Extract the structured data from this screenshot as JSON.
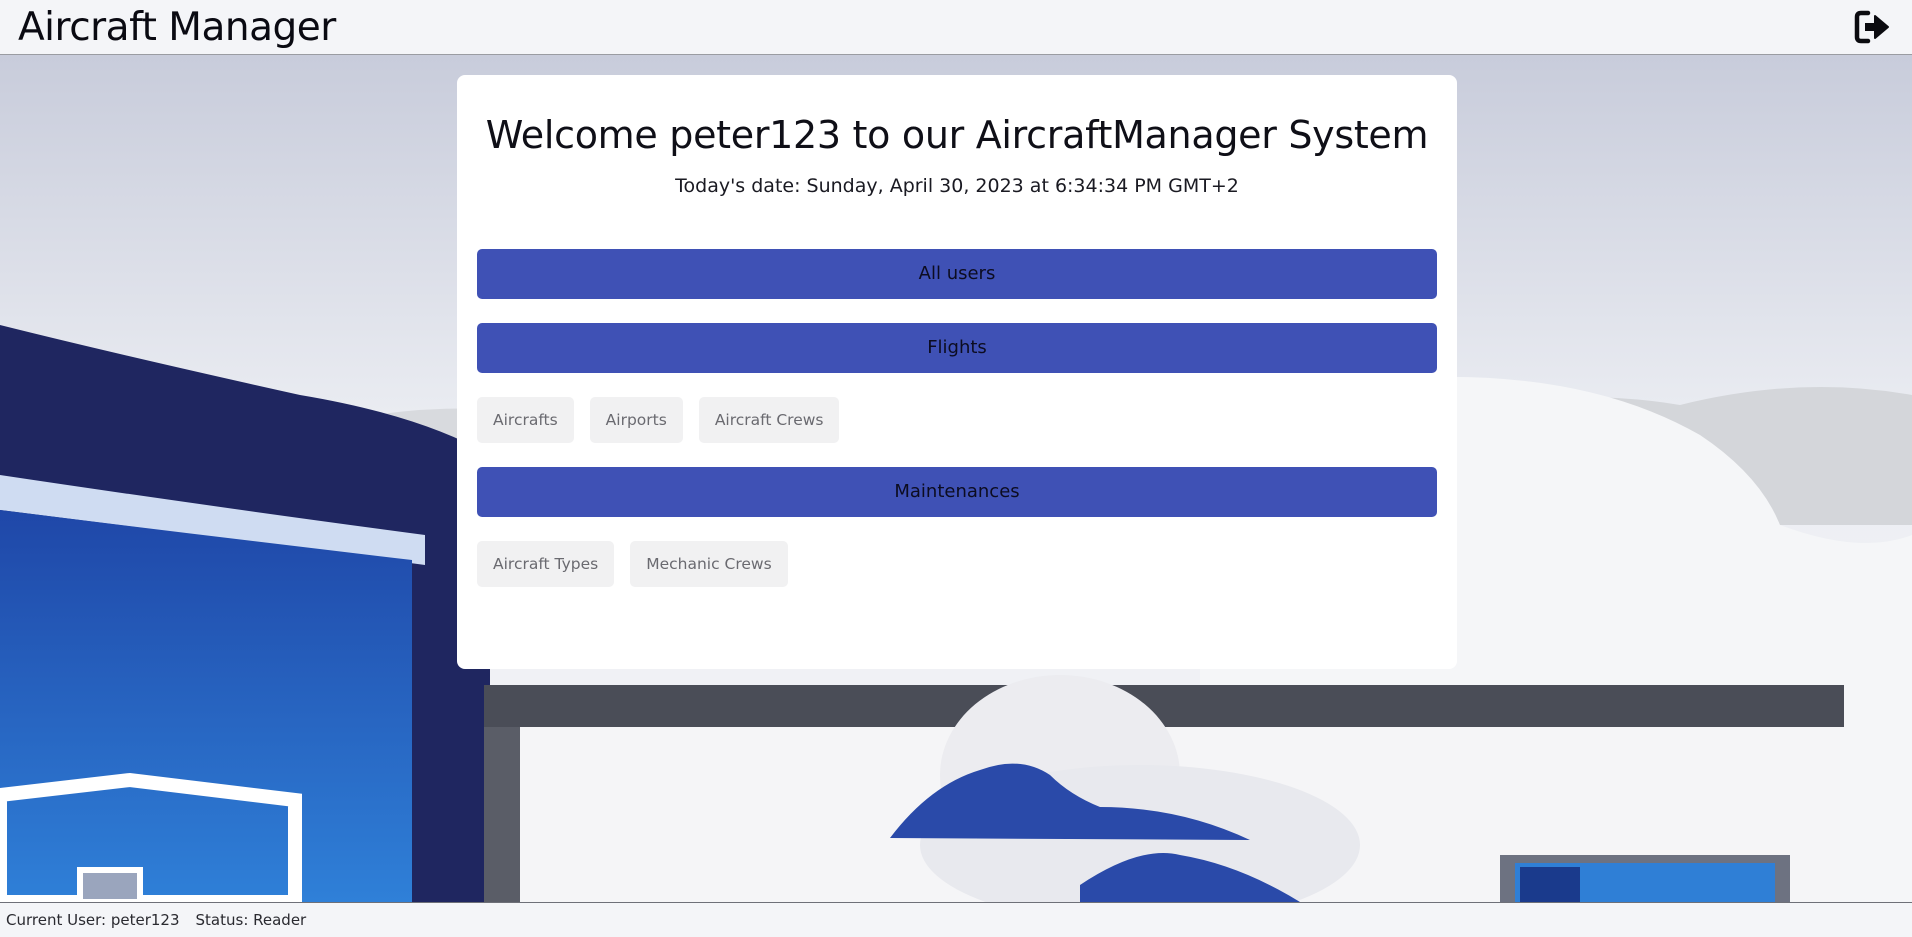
{
  "header": {
    "title": "Aircraft Manager",
    "logout_icon": "logout-icon"
  },
  "card": {
    "welcome": "Welcome peter123 to our AircraftManager System",
    "date": "Today's date: Sunday, April 30, 2023 at 6:34:34 PM GMT+2",
    "sections": {
      "users": "All users",
      "flights": "Flights",
      "maintenances": "Maintenances"
    },
    "flight_links": [
      "Aircrafts",
      "Airports",
      "Aircraft Crews"
    ],
    "maintenance_links": [
      "Aircraft Types",
      "Mechanic Crews"
    ]
  },
  "status": {
    "user": "Current User: peter123",
    "role": "Status: Reader"
  },
  "colors": {
    "accent": "#3f51b5",
    "background": "#eef0f4"
  }
}
